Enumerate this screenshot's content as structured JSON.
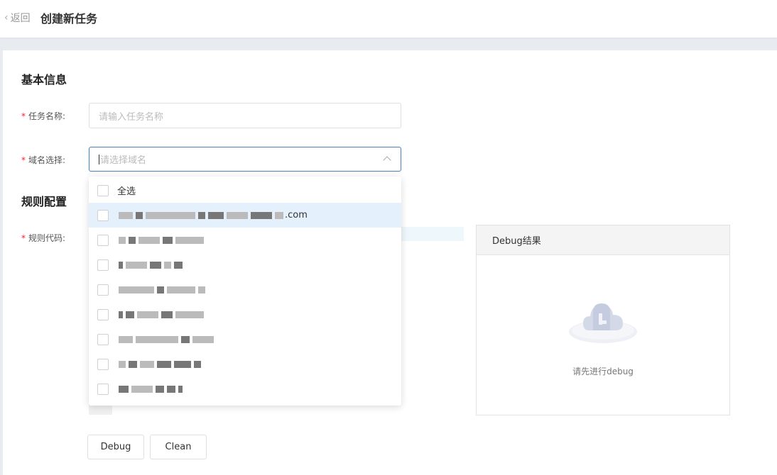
{
  "header": {
    "back_label": "返回",
    "title": "创建新任务"
  },
  "basic_info": {
    "title": "基本信息",
    "task_name": {
      "label": "任务名称:",
      "placeholder": "请输入任务名称"
    },
    "domain": {
      "label": "域名选择:",
      "placeholder": "请选择域名"
    }
  },
  "dropdown": {
    "options": [
      {
        "label": "全选",
        "checked": false,
        "hover": false
      },
      {
        "label": "███ .com",
        "visible_suffix": ".com",
        "checked": false,
        "hover": true
      }
    ]
  },
  "rules": {
    "title": "规则配置",
    "code_label": "规则代码:"
  },
  "debug_panel": {
    "title": "Debug结果",
    "empty_text": "请先进行debug",
    "icon": "cloud-empty-icon"
  },
  "actions": {
    "debug_label": "Debug",
    "clean_label": "Clean"
  },
  "colors": {
    "required": "#f5222d",
    "focus_border": "#4a7eb5",
    "hover_bg": "#e4f1fd"
  }
}
